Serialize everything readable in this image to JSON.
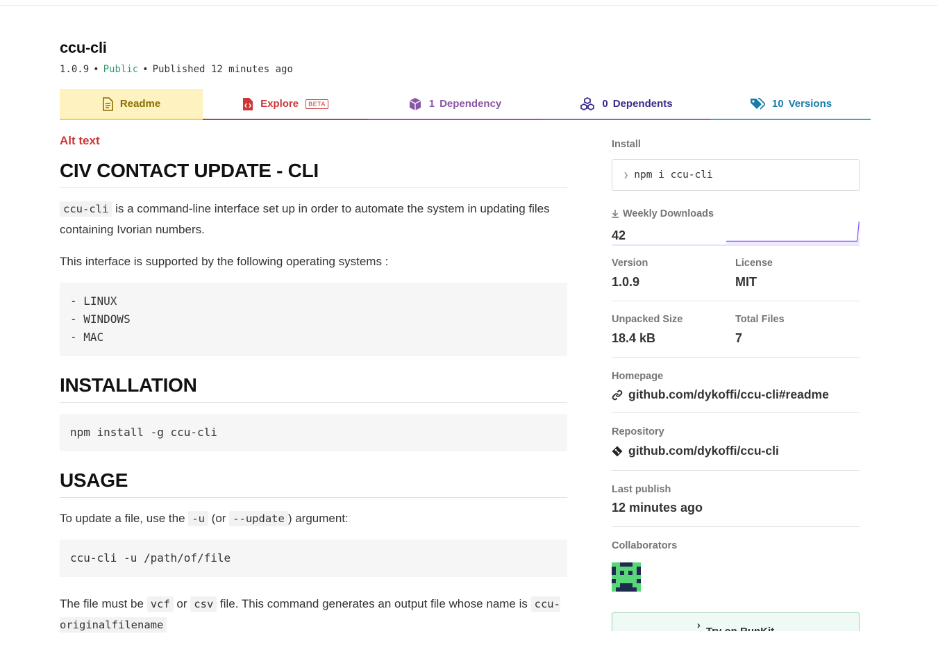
{
  "package": {
    "name": "ccu-cli",
    "version": "1.0.9",
    "visibility": "Public",
    "published": "Published 12 minutes ago",
    "separator": "•"
  },
  "tabs": {
    "readme": "Readme",
    "explore": "Explore",
    "explore_badge": "BETA",
    "dependency_count": "1",
    "dependency_label": "Dependency",
    "dependents_count": "0",
    "dependents_label": "Dependents",
    "versions_count": "10",
    "versions_label": "Versions"
  },
  "readme": {
    "alt_text": "Alt text",
    "title": "CIV CONTACT UPDATE - CLI",
    "intro_code": "ccu-cli",
    "intro_text": "is a command-line interface set up in order to automate the system in updating files containing Ivorian numbers.",
    "supported_text": "This interface is supported by the following operating systems :",
    "os_list": "- LINUX\n- WINDOWS\n- MAC",
    "installation_heading": "INSTALLATION",
    "install_command": "npm install -g ccu-cli",
    "usage_heading": "USAGE",
    "usage_pre": "To update a file, use the",
    "usage_flag_short": "-u",
    "usage_or": "(or",
    "usage_flag_long": "--update",
    "usage_post": ") argument:",
    "usage_command": "ccu-cli -u /path/of/file",
    "file_text_1": "The file must be",
    "file_ext_vcf": "vcf",
    "file_or": "or",
    "file_ext_csv": "csv",
    "file_text_2": "file. This command generates an output file whose name is",
    "file_output_name": "ccu-originalfilename"
  },
  "sidebar": {
    "install_label": "Install",
    "install_command": "npm i ccu-cli",
    "weekly_downloads_label": "Weekly Downloads",
    "weekly_downloads": "42",
    "version_label": "Version",
    "version": "1.0.9",
    "license_label": "License",
    "license": "MIT",
    "unpacked_size_label": "Unpacked Size",
    "unpacked_size": "18.4 kB",
    "total_files_label": "Total Files",
    "total_files": "7",
    "homepage_label": "Homepage",
    "homepage": "github.com/dykoffi/ccu-cli#readme",
    "repository_label": "Repository",
    "repository": "github.com/dykoffi/ccu-cli",
    "last_publish_label": "Last publish",
    "last_publish": "12 minutes ago",
    "collaborators_label": "Collaborators",
    "runkit_label": "Try on RunKit"
  },
  "colors": {
    "npm_red": "#cb3837",
    "readme_tab_bg": "#fdf2c0",
    "public_green": "#2e9e6b",
    "sparkline": "#8956ff",
    "avatar_bg": "#1d2b4f",
    "avatar_fg": "#5ad67a"
  },
  "icons": {
    "readme_tab": "document-icon",
    "explore_tab": "file-code-icon",
    "dependency_tab": "cube-icon",
    "dependents_tab": "cubes-icon",
    "versions_tab": "tags-icon",
    "homepage": "link-icon",
    "repository": "git-diamond-icon",
    "downloads": "download-arrow-icon"
  }
}
